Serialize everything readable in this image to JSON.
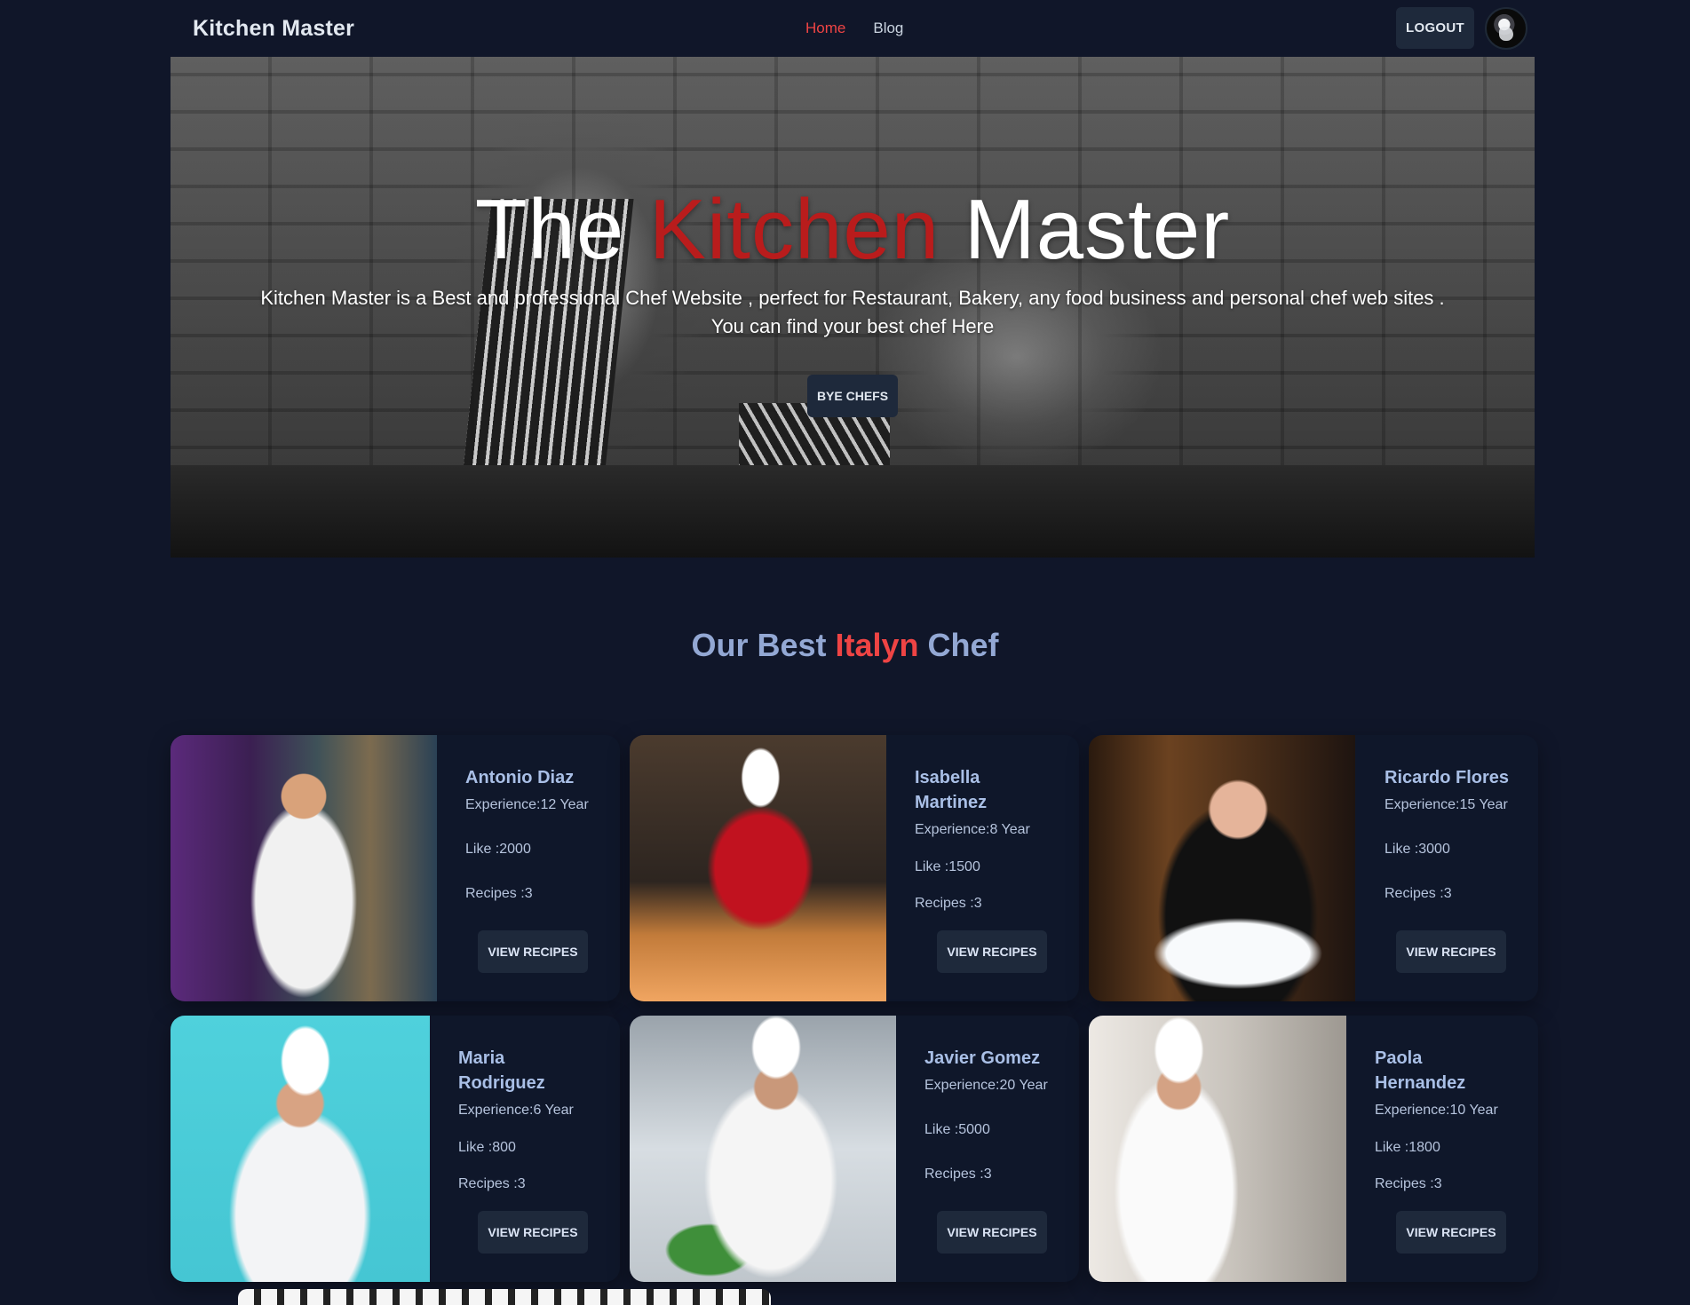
{
  "nav": {
    "brand": "Kitchen Master",
    "links": [
      {
        "label": "Home",
        "active": true
      },
      {
        "label": "Blog",
        "active": false
      }
    ],
    "logout_label": "LOGOUT"
  },
  "hero": {
    "title_part1": "The ",
    "title_accent": "Kitchen",
    "title_part2": " Master",
    "description_line1": "Kitchen Master is a Best and professional Chef Website , perfect for Restaurant, Bakery, any food business and personal chef web sites .",
    "description_line2": "You can find your best chef Here",
    "button_label": "BYE CHEFS"
  },
  "section": {
    "title_part1": "Our Best ",
    "title_accent": "Italyn",
    "title_part2": " Chef"
  },
  "chefs": [
    {
      "name": "Antonio Diaz",
      "experience": "Experience:12 Year",
      "likes": "Like :2000",
      "recipes": "Recipes :3",
      "button": "VIEW RECIPES"
    },
    {
      "name": "Isabella Martinez",
      "experience": "Experience:8 Year",
      "likes": "Like :1500",
      "recipes": "Recipes :3",
      "button": "VIEW RECIPES"
    },
    {
      "name": "Ricardo Flores",
      "experience": "Experience:15 Year",
      "likes": "Like :3000",
      "recipes": "Recipes :3",
      "button": "VIEW RECIPES"
    },
    {
      "name": "Maria Rodriguez",
      "experience": "Experience:6 Year",
      "likes": "Like :800",
      "recipes": "Recipes :3",
      "button": "VIEW RECIPES"
    },
    {
      "name": "Javier Gomez",
      "experience": "Experience:20 Year",
      "likes": "Like :5000",
      "recipes": "Recipes :3",
      "button": "VIEW RECIPES"
    },
    {
      "name": "Paola Hernandez",
      "experience": "Experience:10 Year",
      "likes": "Like :1800",
      "recipes": "Recipes :3",
      "button": "VIEW RECIPES"
    }
  ],
  "colors": {
    "background": "#101629",
    "accent": "#ef4444",
    "title_accent": "#b91c1c",
    "button_bg": "#1e293b"
  }
}
